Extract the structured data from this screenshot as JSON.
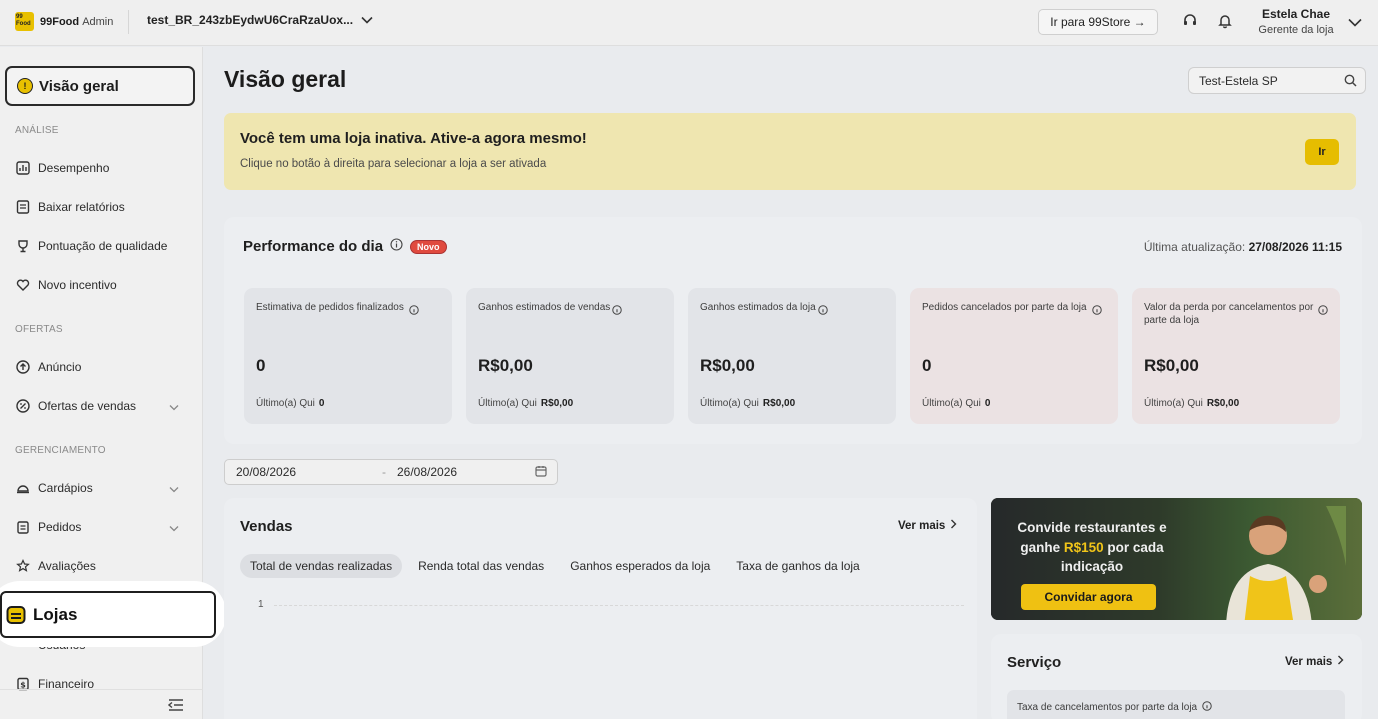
{
  "topbar": {
    "brand_logo_text": "99 Food",
    "brand_name": "99Food",
    "brand_suffix": "Admin",
    "store_name": "test_BR_243zbEydwU6CraRzaUox...",
    "go_to_store": "Ir para 99Store →",
    "user_name": "Estela Chae",
    "user_role": "Gerente da loja"
  },
  "sidebar": {
    "active": "Visão geral",
    "section_analysis": "ANÁLISE",
    "section_offers": "OFERTAS",
    "section_management": "GERENCIAMENTO",
    "items": {
      "desempenho": "Desempenho",
      "baixar": "Baixar relatórios",
      "pontuacao": "Pontuação de qualidade",
      "incentivo": "Novo incentivo",
      "anuncio": "Anúncio",
      "ofertas": "Ofertas de vendas",
      "cardapios": "Cardápios",
      "pedidos": "Pedidos",
      "avaliacoes": "Avaliações",
      "lojas": "Lojas",
      "usuarios": "Usuários",
      "financeiro": "Financeiro"
    }
  },
  "main": {
    "title": "Visão geral",
    "store_search_value": "Test-Estela SP",
    "banner": {
      "title": "Você tem uma loja inativa. Ative-a agora mesmo!",
      "subtitle": "Clique no botão à direita para selecionar a loja a ser ativada",
      "button": "Ir"
    },
    "performance": {
      "title": "Performance do dia",
      "badge": "Novo",
      "updated_label": "Última atualização:",
      "updated_value": "27/08/2026 11:15",
      "metrics": [
        {
          "label": "Estimativa de pedidos finalizados",
          "value": "0",
          "last_label": "Último(a) Qui",
          "last_value": "0"
        },
        {
          "label": "Ganhos estimados de vendas",
          "value": "R$0,00",
          "last_label": "Último(a) Qui",
          "last_value": "R$0,00"
        },
        {
          "label": "Ganhos estimados da loja",
          "value": "R$0,00",
          "last_label": "Último(a) Qui",
          "last_value": "R$0,00"
        },
        {
          "label": "Pedidos cancelados por parte da loja",
          "value": "0",
          "last_label": "Último(a) Qui",
          "last_value": "0"
        },
        {
          "label": "Valor da perda por cancelamentos por parte da loja",
          "value": "R$0,00",
          "last_label": "Último(a) Qui",
          "last_value": "R$0,00"
        }
      ]
    },
    "date_range": {
      "start": "20/08/2026",
      "separator": "-",
      "end": "26/08/2026"
    },
    "sales": {
      "title": "Vendas",
      "see_more": "Ver mais",
      "tabs": [
        "Total de vendas realizadas",
        "Renda total das vendas",
        "Ganhos esperados da loja",
        "Taxa de ganhos da loja"
      ],
      "y_tick": "1"
    },
    "promo": {
      "line1": "Convide restaurantes e",
      "line2_pre": "ganhe ",
      "line2_hl": "R$150",
      "line2_post": " por cada",
      "line3": "indicação",
      "button": "Convidar agora"
    },
    "service": {
      "title": "Serviço",
      "see_more": "Ver mais",
      "metric_label": "Taxa de cancelamentos por parte da loja"
    }
  },
  "colors": {
    "accent": "#e8c000",
    "badge": "#e04a3f",
    "banner_bg": "#efe6b0"
  }
}
